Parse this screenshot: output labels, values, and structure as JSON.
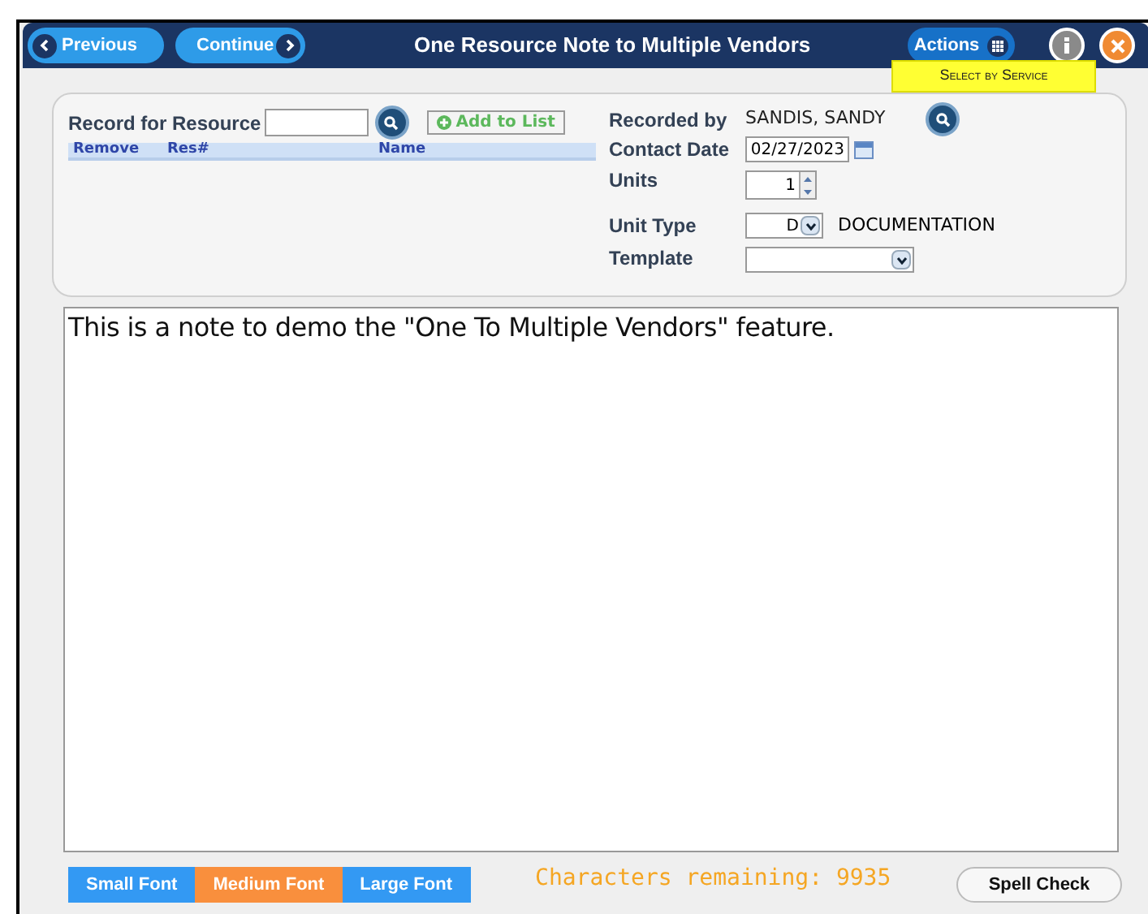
{
  "header": {
    "previous": "Previous",
    "continue": "Continue",
    "title": "One Resource Note to Multiple Vendors",
    "actions": "Actions"
  },
  "tooltip": "Select by Service",
  "resource": {
    "label": "Record for Resource",
    "add_button": "Add to List",
    "columns": [
      "Remove",
      "Res#",
      "Name"
    ]
  },
  "details": {
    "recorded_by_label": "Recorded by",
    "recorded_by": "SANDIS, SANDY",
    "contact_date_label": "Contact Date",
    "contact_date": "02/27/2023",
    "units_label": "Units",
    "units": "1",
    "unit_type_label": "Unit Type",
    "unit_type": "D",
    "unit_type_desc": "DOCUMENTATION",
    "template_label": "Template"
  },
  "note": "This is a note to demo the \"One To Multiple Vendors\" feature.",
  "font_buttons": [
    {
      "label": "Small Font",
      "selected": false
    },
    {
      "label": "Medium Font",
      "selected": true
    },
    {
      "label": "Large Font",
      "selected": false
    }
  ],
  "chars_remaining": "Characters remaining: 9935",
  "spell_check": "Spell Check"
}
